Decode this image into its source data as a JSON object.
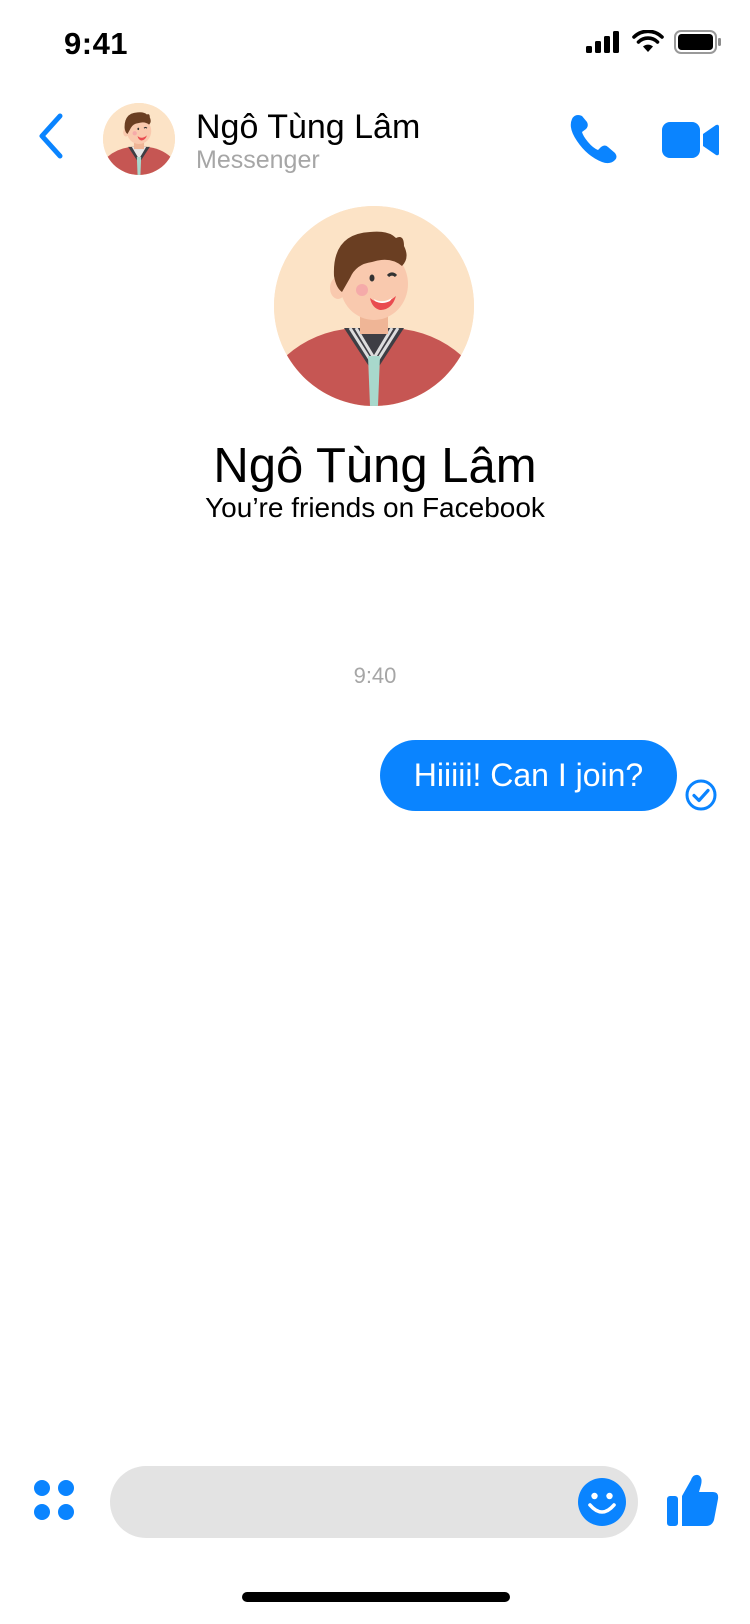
{
  "status_bar": {
    "time": "9:41"
  },
  "header": {
    "contact_name": "Ngô Tùng Lâm",
    "subtitle": "Messenger"
  },
  "profile": {
    "name": "Ngô Tùng Lâm",
    "relationship": "You’re friends on Facebook"
  },
  "conversation": {
    "timestamp": "9:40",
    "messages": [
      {
        "text": "Hiiiii! Can I join?",
        "sender": "me",
        "status": "sent-check-icon"
      }
    ]
  },
  "composer": {
    "placeholder": "",
    "value": ""
  },
  "colors": {
    "accent": "#0A84FF",
    "bubble_text": "#FFFFFF",
    "secondary_text": "#A6A6A6",
    "input_bg": "#E3E3E3",
    "avatar_bg": "#FCE3C6",
    "shirt": "#C65653",
    "hair": "#6A3E22",
    "skin": "#F9C9AE"
  },
  "icons": {
    "back": "chevron-left-icon",
    "call": "phone-icon",
    "video": "video-camera-icon",
    "apps": "four-dots-icon",
    "emoji": "smiley-icon",
    "like": "thumbs-up-icon"
  }
}
